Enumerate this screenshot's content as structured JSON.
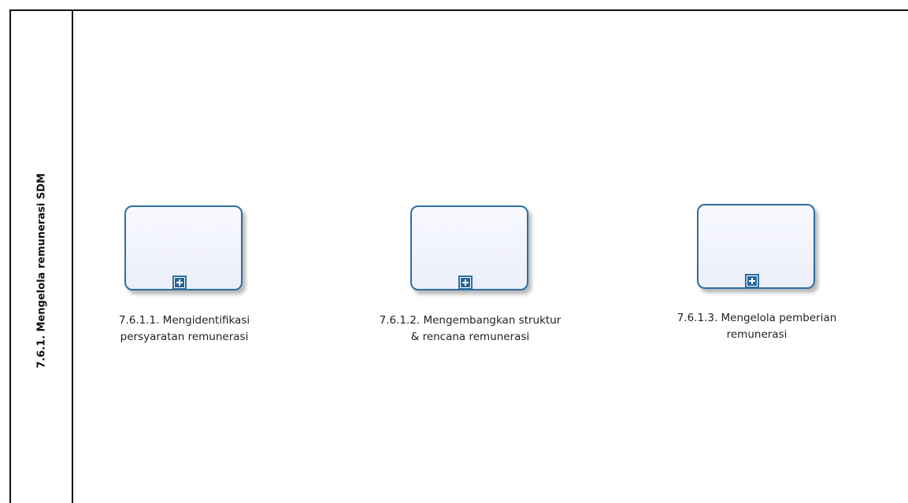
{
  "lane": {
    "title": "7.6.1. Mengelola remunerasi SDM"
  },
  "tasks": [
    {
      "line1": "7.6.1.1. Mengidentifikasi",
      "line2": "persyaratan remunerasi",
      "icon": "expand-plus-icon"
    },
    {
      "line1": "7.6.1.2. Mengembangkan struktur",
      "line2": "& rencana remunerasi",
      "icon": "expand-plus-icon"
    },
    {
      "line1": "7.6.1.3. Mengelola pemberian",
      "line2": "remunerasi",
      "icon": "expand-plus-icon"
    }
  ],
  "colors": {
    "task_border": "#2d6ea3",
    "task_fill": "#eceef9",
    "frame": "#111111"
  }
}
